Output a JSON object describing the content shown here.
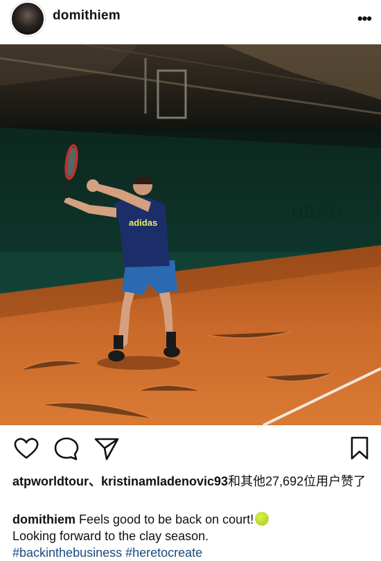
{
  "post": {
    "username": "domithiem",
    "more_label": "•••"
  },
  "actions": {
    "like_icon": "heart-outline-icon",
    "comment_icon": "comment-bubble-icon",
    "share_icon": "paper-plane-icon",
    "bookmark_icon": "bookmark-outline-icon"
  },
  "likes": {
    "users": "atpworldtour、kristinamladenovic93",
    "text": "和其他27,692位用户赞了"
  },
  "caption": {
    "username": "domithiem",
    "line1": "Feels good to be back on court!",
    "emoji": "tennis-ball",
    "line2": "Looking forward to the clay season.",
    "hashtags": "#backinthebusiness #heretocreate"
  },
  "colors": {
    "clay": "#c56a25",
    "wall": "#103a2e",
    "hashtag": "#1a4a82"
  }
}
